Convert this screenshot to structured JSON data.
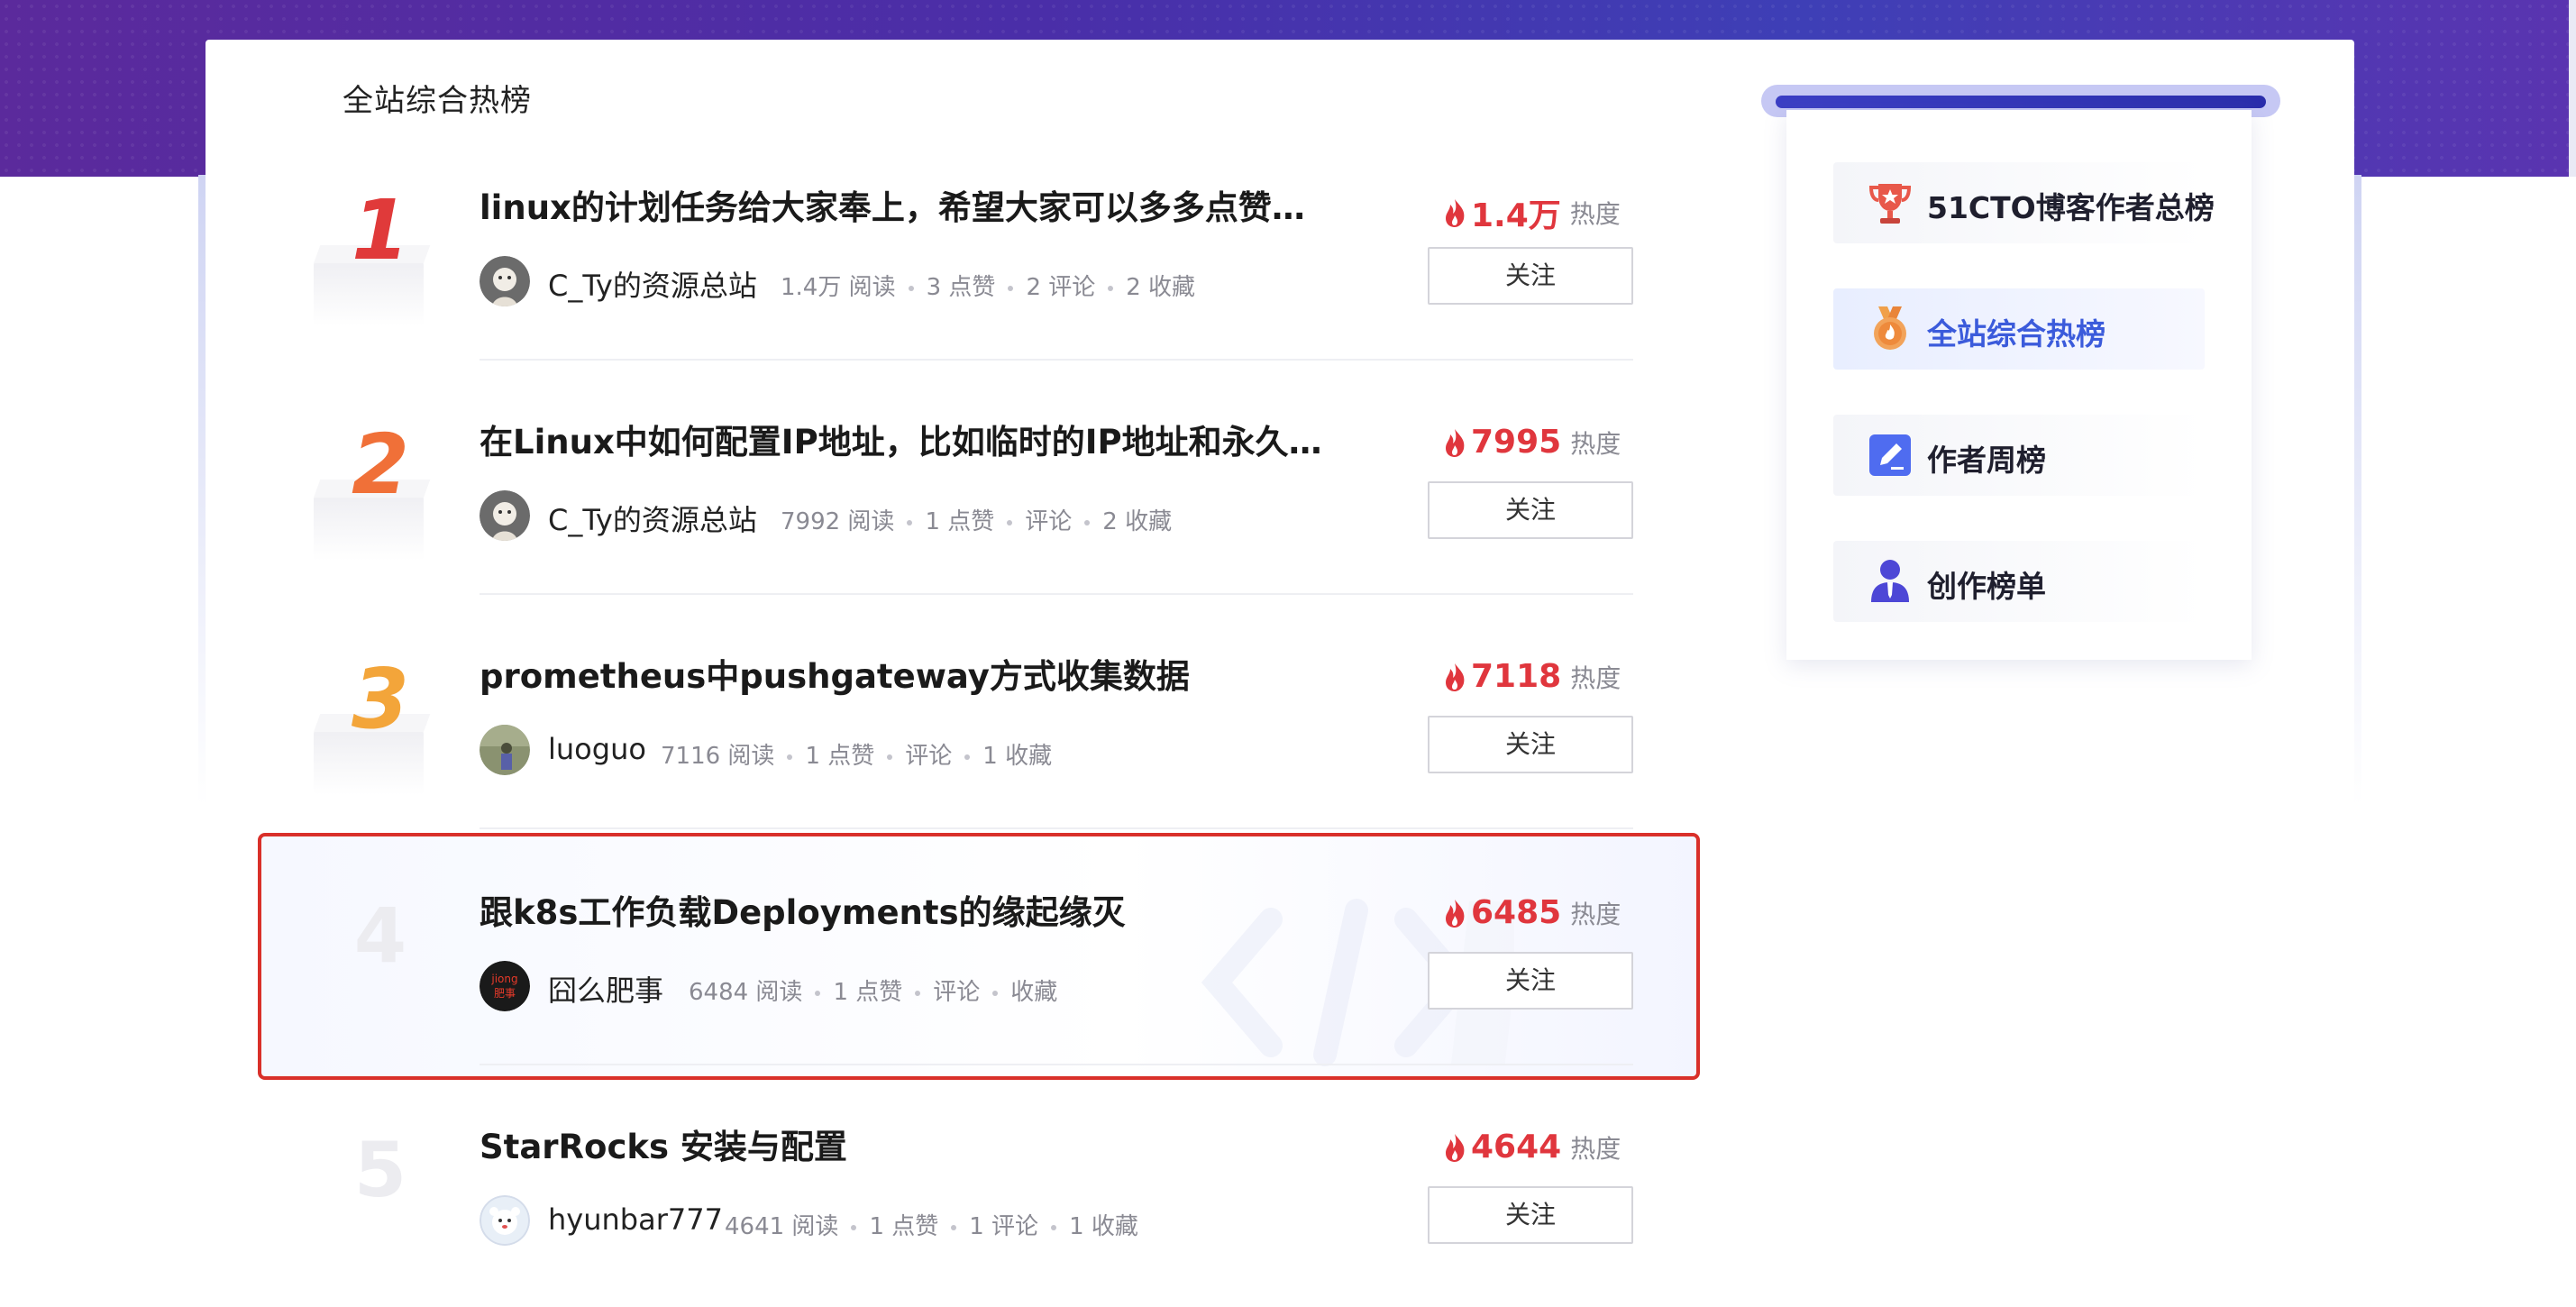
{
  "page": {
    "title": "全站综合热榜"
  },
  "colors": {
    "banner": "#4a2ea8",
    "heat": "#e0363d",
    "highlight_border": "#d9302a",
    "active_side": "#3b5bdb"
  },
  "ranking": [
    {
      "rank": "1",
      "title": "linux的计划任务给大家奉上，希望大家可以多多点赞，…",
      "author": "C_Ty的资源总站",
      "reads": "1.4万 阅读",
      "likes": "3 点赞",
      "comments": "2 评论",
      "favorites": "2 收藏",
      "heat_value": "1.4万",
      "heat_label": "热度",
      "follow": "关注",
      "avatar_icon": "avatar-cartoon-icon"
    },
    {
      "rank": "2",
      "title": "在Linux中如何配置IP地址，比如临时的IP地址和永久IP…",
      "author": "C_Ty的资源总站",
      "reads": "7992 阅读",
      "likes": "1 点赞",
      "comments": "评论",
      "favorites": "2 收藏",
      "heat_value": "7995",
      "heat_label": "热度",
      "follow": "关注",
      "avatar_icon": "avatar-cartoon-icon"
    },
    {
      "rank": "3",
      "title": "prometheus中pushgateway方式收集数据",
      "author": "luoguo",
      "reads": "7116 阅读",
      "likes": "1 点赞",
      "comments": "评论",
      "favorites": "1 收藏",
      "heat_value": "7118",
      "heat_label": "热度",
      "follow": "关注",
      "avatar_icon": "avatar-photo-icon"
    },
    {
      "rank": "4",
      "title": "跟k8s工作负载Deployments的缘起缘灭",
      "author": "囧么肥事",
      "reads": "6484 阅读",
      "likes": "1 点赞",
      "comments": "评论",
      "favorites": "收藏",
      "heat_value": "6485",
      "heat_label": "热度",
      "follow": "关注",
      "avatar_icon": "avatar-logo-icon",
      "avatar_text": "jiong\n肥事"
    },
    {
      "rank": "5",
      "title": "StarRocks 安装与配置",
      "author": "hyunbar777",
      "reads": "4641 阅读",
      "likes": "1 点赞",
      "comments": "1 评论",
      "favorites": "1 收藏",
      "heat_value": "4644",
      "heat_label": "热度",
      "follow": "关注",
      "avatar_icon": "avatar-bear-icon"
    }
  ],
  "sidebar": {
    "items": [
      {
        "label": "51CTO博客作者总榜",
        "icon": "trophy-icon"
      },
      {
        "label": "全站综合热榜",
        "icon": "medal-icon",
        "active": true
      },
      {
        "label": "作者周榜",
        "icon": "edit-icon"
      },
      {
        "label": "创作榜单",
        "icon": "person-icon"
      }
    ]
  }
}
